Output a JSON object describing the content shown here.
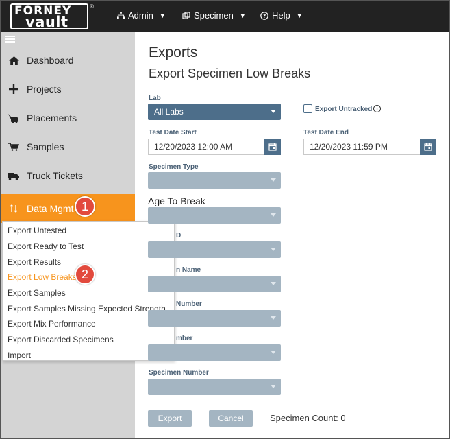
{
  "brand": {
    "logo_top": "FORNEY",
    "logo_bottom": "vault",
    "reg": "®"
  },
  "topnav": [
    {
      "label": "Admin",
      "icon": "sitemap-icon"
    },
    {
      "label": "Specimen",
      "icon": "specimen-icon"
    },
    {
      "label": "Help",
      "icon": "help-circle-icon"
    }
  ],
  "sidebar": {
    "items": [
      {
        "label": "Dashboard",
        "icon": "home-icon"
      },
      {
        "label": "Projects",
        "icon": "plus-icon"
      },
      {
        "label": "Placements",
        "icon": "placement-icon"
      },
      {
        "label": "Samples",
        "icon": "cart-icon"
      },
      {
        "label": "Truck Tickets",
        "icon": "truck-icon"
      },
      {
        "label": "Data Mgmt",
        "icon": "sort-arrows-icon",
        "active": true
      }
    ]
  },
  "data_menu": {
    "items": [
      "Export Untested",
      "Export Ready to Test",
      "Export Results",
      "Export Low Breaks",
      "Export Samples",
      "Export Samples Missing Expected Strength",
      "Export Mix Performance",
      "Export Discarded Specimens",
      "Import"
    ],
    "selected": "Export Low Breaks"
  },
  "callouts": [
    "1",
    "2"
  ],
  "main": {
    "title": "Exports",
    "subtitle": "Export Specimen Low Breaks",
    "lab_label": "Lab",
    "lab_value": "All Labs",
    "export_untracked_label": "Export Untracked",
    "test_date_start_label": "Test Date Start",
    "test_date_start_value": "12/20/2023 12:00 AM",
    "test_date_end_label": "Test Date End",
    "test_date_end_value": "12/20/2023 11:59 PM",
    "specimen_type_label": "Specimen Type",
    "age_to_break_label": "Age To Break",
    "field3_label": "D",
    "field4_label": "n Name",
    "field5_label": "Number",
    "field6_label": "mber",
    "specimen_number_label": "Specimen Number",
    "export_button": "Export",
    "cancel_button": "Cancel",
    "specimen_count": "Specimen Count: 0"
  },
  "colors": {
    "accent": "#f7941d",
    "select_dark": "#4d6e8a",
    "select_disabled": "#a4b5c2",
    "topbar": "#222222",
    "callout": "#e24a3d"
  }
}
